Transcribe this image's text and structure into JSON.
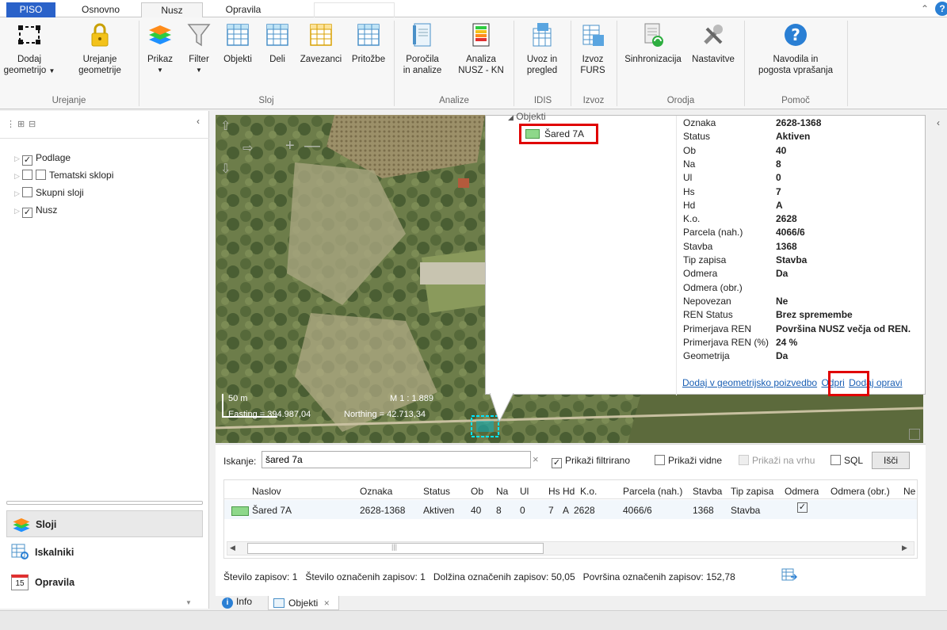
{
  "tabs": [
    {
      "label": "PISO"
    },
    {
      "label": "Osnovno"
    },
    {
      "label": "Nusz"
    },
    {
      "label": "Opravila"
    }
  ],
  "ribbon": {
    "urejanje": {
      "label": "Urejanje",
      "dodaj_l1": "Dodaj",
      "dodaj_l2": "geometrijo",
      "urejanje_l1": "Urejanje",
      "urejanje_l2": "geometrije"
    },
    "sloj": {
      "label": "Sloj",
      "prikaz": "Prikaz",
      "filter": "Filter",
      "objekti": "Objekti",
      "deli": "Deli",
      "zavezanci": "Zavezanci",
      "pritozbe": "Pritožbe"
    },
    "analize": {
      "label": "Analize",
      "porocila_l1": "Poročila",
      "porocila_l2": "in analize",
      "analiza_l1": "Analiza",
      "analiza_l2": "NUSZ - KN"
    },
    "idis": {
      "label": "IDIS",
      "uvoz_l1": "Uvoz in",
      "uvoz_l2": "pregled"
    },
    "izvoz": {
      "label": "Izvoz",
      "izvoz_l1": "Izvoz",
      "izvoz_l2": "FURS"
    },
    "orodja": {
      "label": "Orodja",
      "sinhronizacija": "Sinhronizacija",
      "nastavitve": "Nastavitve"
    },
    "pomoc": {
      "label": "Pomoč",
      "navodila_l1": "Navodila in",
      "navodila_l2": "pogosta vprašanja"
    }
  },
  "layers": [
    {
      "label": "Podlage",
      "checked": true
    },
    {
      "label": "Tematski sklopi",
      "checked": false
    },
    {
      "label": "Skupni sloji",
      "checked": false
    },
    {
      "label": "Nusz",
      "checked": true
    }
  ],
  "nav": {
    "sloji": "Sloji",
    "iskalniki": "Iskalniki",
    "opravila": "Opravila",
    "calendar_day": "15"
  },
  "map": {
    "scale_bar": "50 m",
    "scale": "M 1 : 1.889",
    "easting": "Easting = 394.987,04",
    "northing": "Northing = 42.713,34"
  },
  "popup": {
    "tree_root": "Objekti",
    "tree_item": "Šared 7A",
    "fields": [
      {
        "label": "Oznaka",
        "value": "2628-1368"
      },
      {
        "label": "Status",
        "value": "Aktiven"
      },
      {
        "label": "Ob",
        "value": "40"
      },
      {
        "label": "Na",
        "value": "8"
      },
      {
        "label": "Ul",
        "value": "0"
      },
      {
        "label": "Hs",
        "value": "7"
      },
      {
        "label": "Hd",
        "value": "A"
      },
      {
        "label": "K.o.",
        "value": "2628"
      },
      {
        "label": "Parcela (nah.)",
        "value": "4066/6"
      },
      {
        "label": "Stavba",
        "value": "1368"
      },
      {
        "label": "Tip zapisa",
        "value": "Stavba"
      },
      {
        "label": "Odmera",
        "value": "Da"
      },
      {
        "label": "Odmera (obr.)",
        "value": ""
      },
      {
        "label": "Nepovezan",
        "value": "Ne"
      },
      {
        "label": "REN Status",
        "value": "Brez spremembe"
      },
      {
        "label": "Primerjava REN",
        "value": "Površina NUSZ večja od REN."
      },
      {
        "label": "Primerjava REN (%)",
        "value": "24 %"
      },
      {
        "label": "Geometrija",
        "value": "Da"
      }
    ],
    "link_dodaj": "Dodaj v geometrijsko poizvedbo",
    "link_odpri": "Odpri",
    "link_opravilo": "Dodaj opravi"
  },
  "search": {
    "label": "Iskanje:",
    "value": "šared 7a",
    "prikazi_filtrirano": "Prikaži filtrirano",
    "prikazi_vidne": "Prikaži vidne",
    "prikazi_na_vrhu": "Prikaži na vrhu",
    "sql": "SQL",
    "isci": "Išči"
  },
  "table": {
    "headers": [
      "Naslov",
      "Oznaka",
      "Status",
      "Ob",
      "Na",
      "Ul",
      "Hs",
      "Hd",
      "K.o.",
      "Parcela (nah.)",
      "Stavba",
      "Tip zapisa",
      "Odmera",
      "Odmera (obr.)",
      "Ne"
    ],
    "row": [
      "Šared 7A",
      "2628-1368",
      "Aktiven",
      "40",
      "8",
      "0",
      "7",
      "A",
      "2628",
      "4066/6",
      "1368",
      "Stavba",
      "",
      "",
      ""
    ]
  },
  "summary": {
    "zapisov": "Število zapisov: 1",
    "oznacenih": "Število označenih zapisov: 1",
    "dolzina": "Dolžina označenih zapisov: 50,05",
    "povrsina": "Površina označenih zapisov: 152,78"
  },
  "bottom_tabs": {
    "info": "Info",
    "objekti": "Objekti"
  },
  "colors": {
    "accent": "#2a62c9",
    "highlight_red": "#e00000",
    "feature_green": "#8ed88a",
    "feature_cyan": "#00e5ff"
  }
}
